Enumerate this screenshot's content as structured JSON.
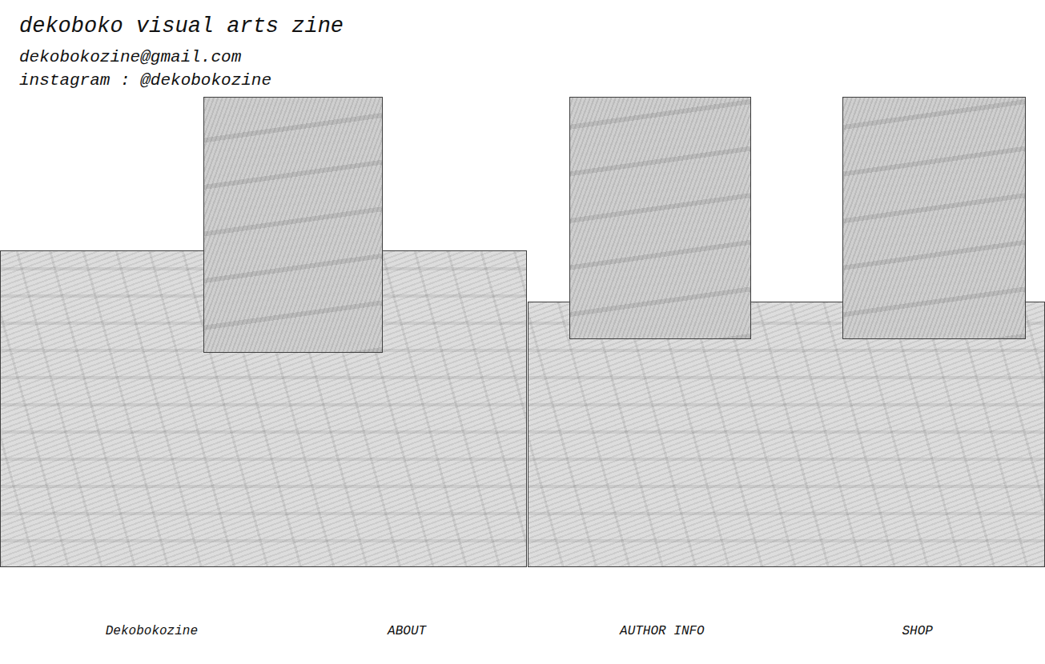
{
  "header": {
    "title": "dekoboko visual arts zine",
    "email": "dekobokozine@gmail.com",
    "instagram": "instagram : @dekobokozine"
  },
  "nav": [
    {
      "label": "Dekobokozine"
    },
    {
      "label": "ABOUT"
    },
    {
      "label": "AUTHOR INFO"
    },
    {
      "label": "SHOP"
    }
  ]
}
